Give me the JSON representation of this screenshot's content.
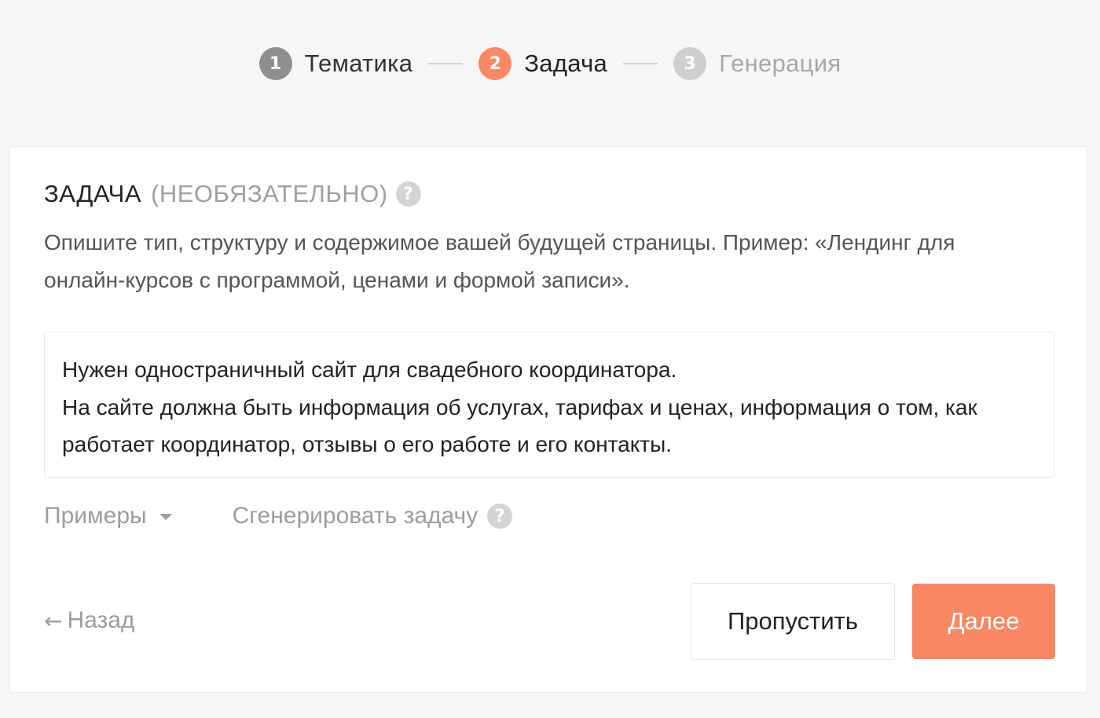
{
  "stepper": {
    "steps": [
      {
        "number": "1",
        "label": "Тематика",
        "state": "done"
      },
      {
        "number": "2",
        "label": "Задача",
        "state": "active"
      },
      {
        "number": "3",
        "label": "Генерация",
        "state": "pending"
      }
    ]
  },
  "task": {
    "title": "ЗАДАЧА",
    "title_optional": "(НЕОБЯЗАТЕЛЬНО)",
    "help_glyph": "?",
    "description_line1": "Опишите тип, структуру и содержимое вашей будущей страницы. Пример: «Лендинг для",
    "description_line2": "онлайн-курсов с программой, ценами и формой записи».",
    "value_lines": [
      "Нужен одностраничный сайт для свадебного координатора.",
      "На сайте должна быть информация об услугах, тарифах и ценах, информация о том, как",
      "работает координатор, отзывы о его работе и его контакты."
    ]
  },
  "helpers": {
    "examples_label": "Примеры",
    "generate_label": "Сгенерировать задачу",
    "help_glyph": "?"
  },
  "actions": {
    "back_arrow": "←",
    "back_label": "Назад",
    "skip_label": "Пропустить",
    "next_label": "Далее"
  },
  "colors": {
    "accent": "#fb8862",
    "step_done": "#8f8f8f",
    "step_pending": "#cfcfcf",
    "muted_text": "#9d9d9d",
    "background": "#f6f6f6"
  },
  "icons": {
    "help": "question-circle-icon",
    "dropdown": "caret-down-icon",
    "back": "arrow-left-icon"
  }
}
